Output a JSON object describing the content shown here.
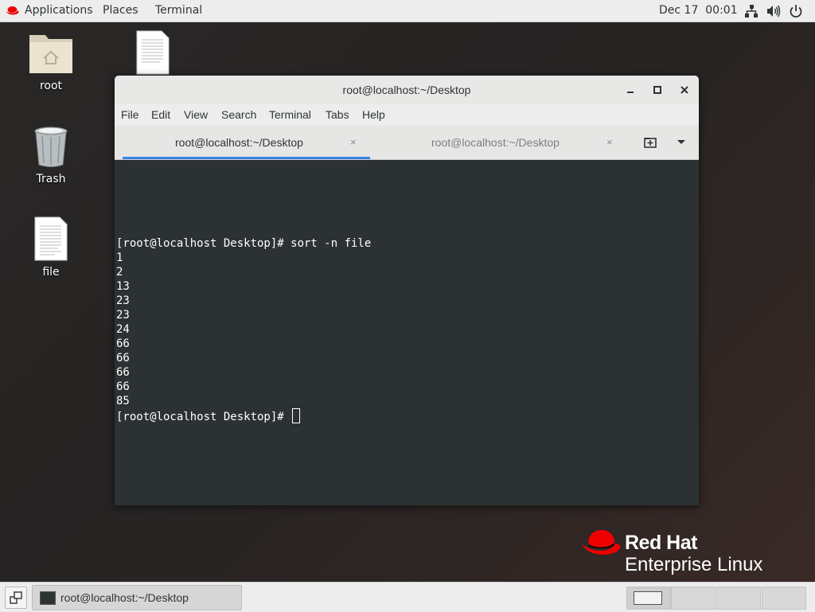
{
  "topbar": {
    "applications": "Applications",
    "places": "Places",
    "terminal": "Terminal",
    "date": "Dec 17",
    "time": "00:01",
    "icons": [
      "network-icon",
      "volume-icon",
      "power-icon"
    ]
  },
  "desktop": {
    "icons": [
      {
        "label": "root",
        "icon": "home-folder-icon"
      },
      {
        "label": "Trash",
        "icon": "trash-icon"
      },
      {
        "label": "file",
        "icon": "text-file-icon"
      },
      {
        "label": "",
        "icon": "text-file-icon"
      }
    ]
  },
  "window": {
    "title": "root@localhost:~/Desktop",
    "menu": [
      "File",
      "Edit",
      "View",
      "Search",
      "Terminal",
      "Tabs",
      "Help"
    ],
    "tabs": [
      {
        "label": "root@localhost:~/Desktop",
        "active": true,
        "close": "×"
      },
      {
        "label": "root@localhost:~/Desktop",
        "active": false,
        "close": "×"
      }
    ],
    "new_tab_icon": "new-tab-icon",
    "tab_menu_icon": "chevron-down-icon"
  },
  "terminal": {
    "lines": [
      "[root@localhost Desktop]# sort -n file",
      "1",
      "2",
      "13",
      "23",
      "23",
      "24",
      "66",
      "66",
      "66",
      "66",
      "85",
      "[root@localhost Desktop]# "
    ]
  },
  "branding": {
    "line1": "Red Hat",
    "line2": "Enterprise Linux"
  },
  "taskbar": {
    "task_label": "root@localhost:~/Desktop",
    "workspaces": 4,
    "active_workspace": 1
  },
  "colors": {
    "accent": "#3584e4",
    "redhat_red": "#ee0000",
    "terminal_bg": "#2c3133"
  }
}
